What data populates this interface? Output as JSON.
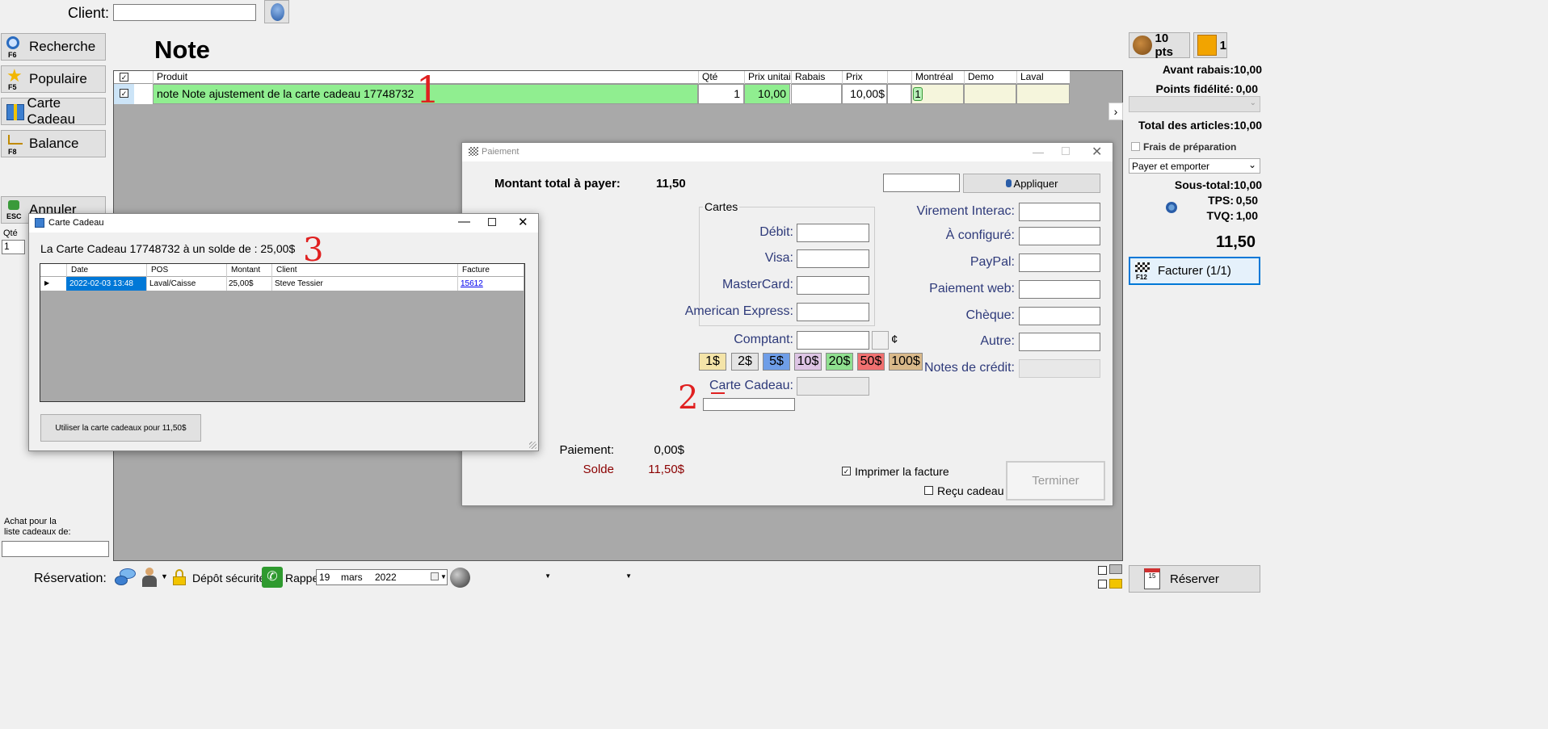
{
  "header": {
    "client_label": "Client:",
    "client_value": "",
    "title": "Note"
  },
  "left_nav": {
    "items": [
      {
        "label": "Recherche",
        "key": "F6"
      },
      {
        "label": "Populaire",
        "key": "F5"
      },
      {
        "label": "Carte Cadeau",
        "key": ""
      },
      {
        "label": "Balance",
        "key": "F8"
      }
    ],
    "cancel": {
      "label": "Annuler",
      "key": "ESC"
    },
    "qty_label": "Qté",
    "qty_value": "1",
    "wishlist_label_1": "Achat pour la",
    "wishlist_label_2": "liste cadeaux de:"
  },
  "order_table": {
    "columns": [
      "Produit",
      "Qté",
      "Prix unitaire",
      "Rabais",
      "Prix",
      "Montréal",
      "Demo",
      "Laval"
    ],
    "row": {
      "product": "note Note  ajustement de la carte cadeau  17748732",
      "qty": "1",
      "unit_price": "10,00",
      "discount": "",
      "price": "10,00$",
      "montreal": "1",
      "demo": "",
      "laval": ""
    }
  },
  "right_panel": {
    "points": "10 pts",
    "gift_count": "1",
    "avant_rabais_label": "Avant rabais:",
    "avant_rabais": "10,00",
    "points_fidelite_label": "Points fidélité:",
    "points_fidelite": "0,00",
    "total_articles_label": "Total des articles:",
    "total_articles": "10,00",
    "frais_label": "Frais de préparation",
    "mode": "Payer et emporter",
    "sous_total_label": "Sous-total:",
    "sous_total": "10,00",
    "tps_label": "TPS:",
    "tps": "0,50",
    "tvq_label": "TVQ:",
    "tvq": "1,00",
    "total": "11,50",
    "facturer_label": "Facturer (1/1)",
    "facturer_key": "F12",
    "reserver_label": "Réserver"
  },
  "payment": {
    "title": "Paiement",
    "total_label": "Montant total à payer:",
    "total": "11,50",
    "apply_label": "Appliquer",
    "cards_group": "Cartes",
    "debit": "Débit:",
    "visa": "Visa:",
    "mastercard": "MasterCard:",
    "amex": "American Express:",
    "cash_label": "Comptant:",
    "cents": "¢",
    "bills": [
      "1$",
      "2$",
      "5$",
      "10$",
      "20$",
      "50$",
      "100$"
    ],
    "gift_card_label": "Carte Cadeau:",
    "right_methods": [
      "Virement Interac:",
      "À configuré:",
      "PayPal:",
      "Paiement web:",
      "Chèque:",
      "Autre:",
      "Notes de crédit:"
    ],
    "paiement_label": "Paiement:",
    "paiement_value": "0,00$",
    "solde_label": "Solde",
    "solde_value": "11,50$",
    "print_invoice": "Imprimer la facture",
    "gift_receipt": "Reçu cadeau",
    "finish": "Terminer"
  },
  "gift_dialog": {
    "title": "Carte Cadeau",
    "balance_text": "La Carte Cadeau 17748732 à un solde de : 25,00$",
    "columns": [
      "Date",
      "POS",
      "Montant",
      "Client",
      "Facture"
    ],
    "rows": [
      {
        "date": "2022-02-03 13:48",
        "pos": "Laval/Caisse",
        "montant": "25,00$",
        "client": "Steve Tessier",
        "facture": "15612"
      }
    ],
    "use_button": "Utiliser la carte cadeaux pour 11,50$"
  },
  "bottom_bar": {
    "reservation_label": "Réservation:",
    "depot": "Dépôt sécurité",
    "rappel": "Rappel",
    "date_day": "19",
    "date_month": "mars",
    "date_year": "2022"
  },
  "annotations": [
    "1",
    "2",
    "3"
  ],
  "colors": {
    "row_green": "#90ee90",
    "accent_blue": "#0078d7",
    "solde_red": "#8b0000",
    "label_blue": "#2e3a7a"
  }
}
